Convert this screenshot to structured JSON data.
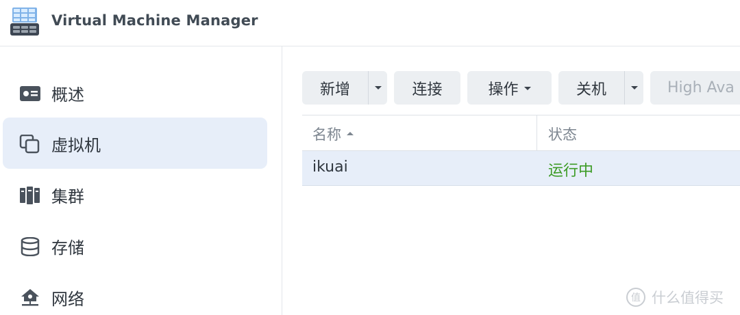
{
  "app": {
    "title": "Virtual Machine Manager",
    "icon": "vmm-server-icon"
  },
  "sidebar": {
    "items": [
      {
        "label": "概述",
        "icon": "overview-card-icon",
        "active": false
      },
      {
        "label": "虚拟机",
        "icon": "virtual-machine-icon",
        "active": true
      },
      {
        "label": "集群",
        "icon": "cluster-icon",
        "active": false
      },
      {
        "label": "存储",
        "icon": "storage-database-icon",
        "active": false
      },
      {
        "label": "网络",
        "icon": "network-icon",
        "active": false
      }
    ]
  },
  "toolbar": {
    "create_label": "新增",
    "connect_label": "连接",
    "action_label": "操作",
    "shutdown_label": "关机",
    "high_availability_label": "High Ava"
  },
  "table": {
    "columns": [
      "名称",
      "状态"
    ],
    "sorted_column": "名称",
    "rows": [
      {
        "name": "ikuai",
        "status": "运行中",
        "status_color": "#3c9b25"
      }
    ]
  },
  "colors": {
    "active_nav_bg": "#e7eef9",
    "button_bg": "#eceff2",
    "running_status": "#3c9b25"
  },
  "watermark": {
    "text": "什么值得买"
  }
}
